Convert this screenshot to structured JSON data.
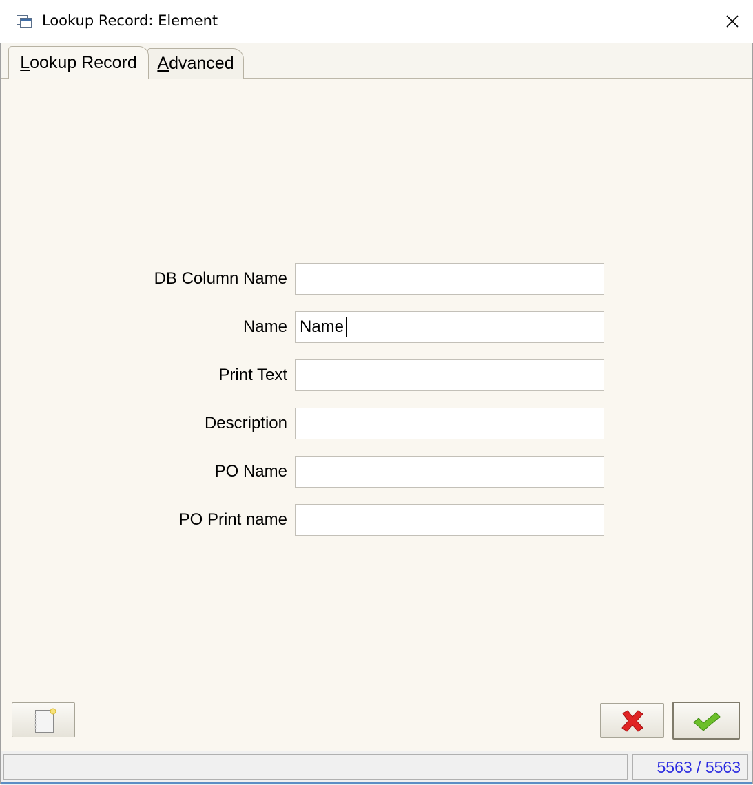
{
  "window": {
    "title": "Lookup Record: Element"
  },
  "tabs": [
    {
      "label": "Lookup Record",
      "mnemonic": "L",
      "rest": "ookup Record",
      "active": true
    },
    {
      "label": "Advanced",
      "mnemonic": "A",
      "rest": "dvanced",
      "active": false
    }
  ],
  "form": {
    "fields": [
      {
        "label": "DB Column Name",
        "value": ""
      },
      {
        "label": "Name",
        "value": "Name"
      },
      {
        "label": "Print Text",
        "value": ""
      },
      {
        "label": "Description",
        "value": ""
      },
      {
        "label": "PO Name",
        "value": ""
      },
      {
        "label": "PO Print name",
        "value": ""
      }
    ]
  },
  "buttons": {
    "new_icon": "new-document-icon",
    "cancel_icon": "red-x-icon",
    "ok_icon": "green-check-icon"
  },
  "status": {
    "left": "",
    "record_counter": "5563 / 5563"
  },
  "colors": {
    "panel_bg": "#faf7f0",
    "counter_text": "#2b2be0",
    "cancel_red": "#e02020",
    "ok_green": "#6cbf2a"
  }
}
